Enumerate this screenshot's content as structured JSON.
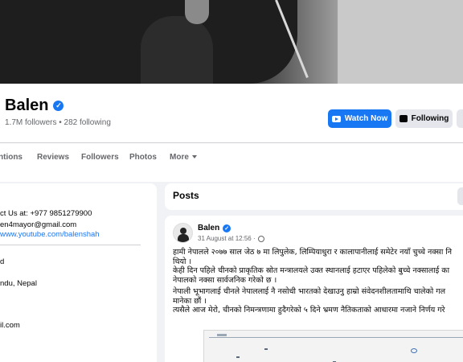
{
  "profile": {
    "name": "Balen",
    "followers_line": "1.7M followers • 282 following",
    "verified_glyph": "✓"
  },
  "actions": {
    "watch_now": "Watch Now",
    "following": "Following"
  },
  "tabs": [
    "ntions",
    "Reviews",
    "Followers",
    "Photos",
    "More"
  ],
  "intro": {
    "lines": [
      "ct Us at: +977 9851279900",
      "en4mayor@gmail.com",
      "www.youtube.com/balenshah",
      "d",
      "ndu, Nepal",
      "il.com"
    ]
  },
  "posts": {
    "title": "Posts"
  },
  "post": {
    "author": "Balen",
    "timestamp": "31 August at 12:56 ·",
    "lines": [
      "हामी नेपालले २०७७ साल जेठ ७ मा लिपुलेक, लिम्पियाधुरा र कालापानीलाई समेटेर नयाँ चुच्चे नक्सा नि",
      "थियो ।",
      "केही दिन पहिले चीनको प्राकृतिक स्रोत मन्त्रालयले उक्त स्थानलाई हटाएर पहिलेको बुच्चे नक्सालाई का",
      "नेपालको नक्सा सार्वजनिक गरेको छ ।",
      "नेपाली भूभागलाई चीनले नेपाललाई नै नसोधी भारतको देखाउनु हाम्रो संवेदनशीलतामाथि चालेको गल",
      "मानेका छौं ।",
      "त्यसैले आज मेरो, चीनको निमन्त्रणामा हुदैगरेको ५ दिने भ्रमण नैतिकताको आधारमा नजाने निर्णय गरे"
    ]
  },
  "colors": {
    "accent": "#1877f2",
    "secondary_text": "#65676b",
    "page_bg": "#f0f2f5"
  },
  "icons": [
    "verified-badge-icon",
    "tv-icon",
    "following-icon",
    "caret-down-icon",
    "globe-icon"
  ]
}
